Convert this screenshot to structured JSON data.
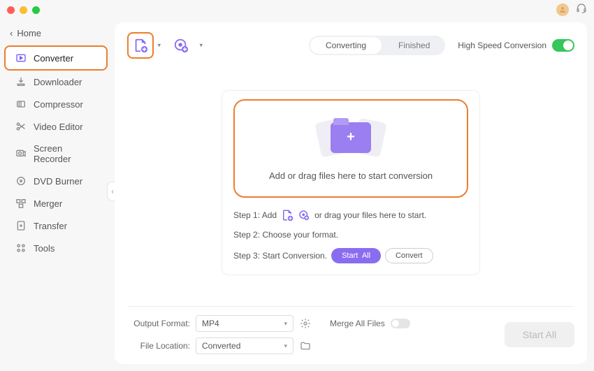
{
  "home_label": "Home",
  "sidebar": {
    "items": [
      {
        "label": "Converter"
      },
      {
        "label": "Downloader"
      },
      {
        "label": "Compressor"
      },
      {
        "label": "Video Editor"
      },
      {
        "label": "Screen Recorder"
      },
      {
        "label": "DVD Burner"
      },
      {
        "label": "Merger"
      },
      {
        "label": "Transfer"
      },
      {
        "label": "Tools"
      }
    ]
  },
  "tabs": {
    "converting": "Converting",
    "finished": "Finished"
  },
  "hsc_label": "High Speed Conversion",
  "dropzone_text": "Add or drag files here to start conversion",
  "steps": {
    "s1_prefix": "Step 1: Add",
    "s1_suffix": "or drag your files here to start.",
    "s2": "Step 2: Choose your format.",
    "s3_prefix": "Step 3: Start Conversion.",
    "start_all_small": "Start  All",
    "convert": "Convert"
  },
  "bottom": {
    "output_format_label": "Output Format:",
    "output_format_value": "MP4",
    "file_location_label": "File Location:",
    "file_location_value": "Converted",
    "merge_label": "Merge All Files",
    "start_all": "Start All"
  }
}
